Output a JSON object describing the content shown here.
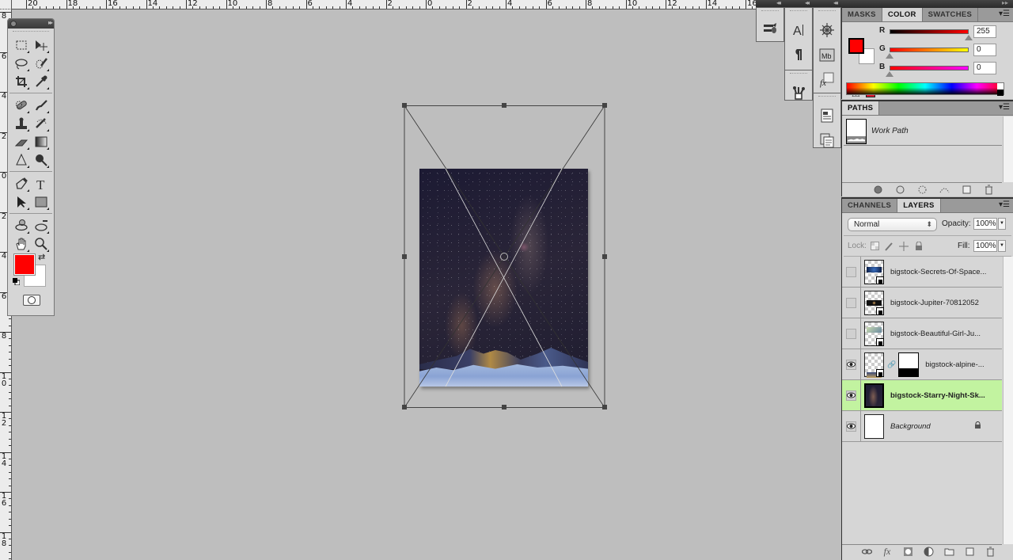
{
  "rulers": {
    "top_labels": [
      "20",
      "18",
      "16",
      "14",
      "12",
      "10",
      "8",
      "6",
      "4",
      "2",
      "0",
      "2",
      "4",
      "6",
      "8",
      "10",
      "12",
      "14",
      "16"
    ],
    "left_labels": [
      "8",
      "6",
      "4",
      "2",
      "0",
      "2",
      "4",
      "6",
      "8",
      "10",
      "12",
      "14",
      "16",
      "18"
    ]
  },
  "toolbox": {
    "tools": [
      [
        "rectangular-marquee",
        "move"
      ],
      [
        "lasso",
        "quick-selection"
      ],
      [
        "crop",
        "eyedropper"
      ],
      [
        "spot-healing-brush",
        "brush"
      ],
      [
        "clone-stamp",
        "history-brush"
      ],
      [
        "eraser",
        "gradient"
      ],
      [
        "blur",
        "dodge"
      ],
      [
        "pen",
        "type"
      ],
      [
        "path-selection",
        "rectangle"
      ],
      [
        "3d-rotate",
        "3d-orbit"
      ],
      [
        "hand",
        "zoom"
      ]
    ],
    "foreground_color": "#ff0000",
    "background_color": "#ffffff"
  },
  "dock": {
    "columns": [
      {
        "buttons": [
          "brush-presets"
        ]
      },
      {
        "buttons": [
          "character",
          "paragraph",
          "tool-presets"
        ]
      },
      {
        "buttons": [
          "navigator",
          "mini-bridge",
          "styles",
          "info",
          "clone-source"
        ]
      }
    ]
  },
  "color_panel": {
    "tabs": [
      "MASKS",
      "COLOR",
      "SWATCHES"
    ],
    "active_tab": "COLOR",
    "channels": [
      {
        "label": "R",
        "value": "255",
        "fraction": 1.0
      },
      {
        "label": "G",
        "value": "0",
        "fraction": 0.0
      },
      {
        "label": "B",
        "value": "0",
        "fraction": 0.0
      }
    ],
    "foreground": "#ff0000",
    "background": "#ffffff",
    "gamut_color": "#e2182e"
  },
  "paths_panel": {
    "tabs": [
      "PATHS"
    ],
    "paths": [
      {
        "name": "Work Path"
      }
    ],
    "footer": [
      "fill-path",
      "stroke-path",
      "load-selection",
      "make-work-path",
      "new-path",
      "delete-path"
    ]
  },
  "layers_panel": {
    "tabs": [
      "CHANNELS",
      "LAYERS"
    ],
    "active_tab": "LAYERS",
    "blend_mode": "Normal",
    "opacity_label": "Opacity:",
    "opacity": "100%",
    "lock_label": "Lock:",
    "fill_label": "Fill:",
    "fill": "100%",
    "layers": [
      {
        "name": "bigstock-Secrets-Of-Space...",
        "visible": false,
        "smart_object": true
      },
      {
        "name": "bigstock-Jupiter-70812052",
        "visible": false,
        "smart_object": true
      },
      {
        "name": "bigstock-Beautiful-Girl-Ju...",
        "visible": false,
        "smart_object": true
      },
      {
        "name": "bigstock-alpine-...",
        "visible": true,
        "smart_object": true,
        "mask": true
      },
      {
        "name": "bigstock-Starry-Night-Sk...",
        "visible": true,
        "selected": true
      },
      {
        "name": "Background",
        "visible": true,
        "locked": true
      }
    ],
    "footer": [
      "link-layers",
      "add-layer-style",
      "add-mask",
      "new-adjustment-layer",
      "new-group",
      "new-layer",
      "delete-layer"
    ]
  },
  "accent_colors": {
    "selected_layer": "#c2f3a0",
    "canvas_bg": "#bebebe"
  }
}
